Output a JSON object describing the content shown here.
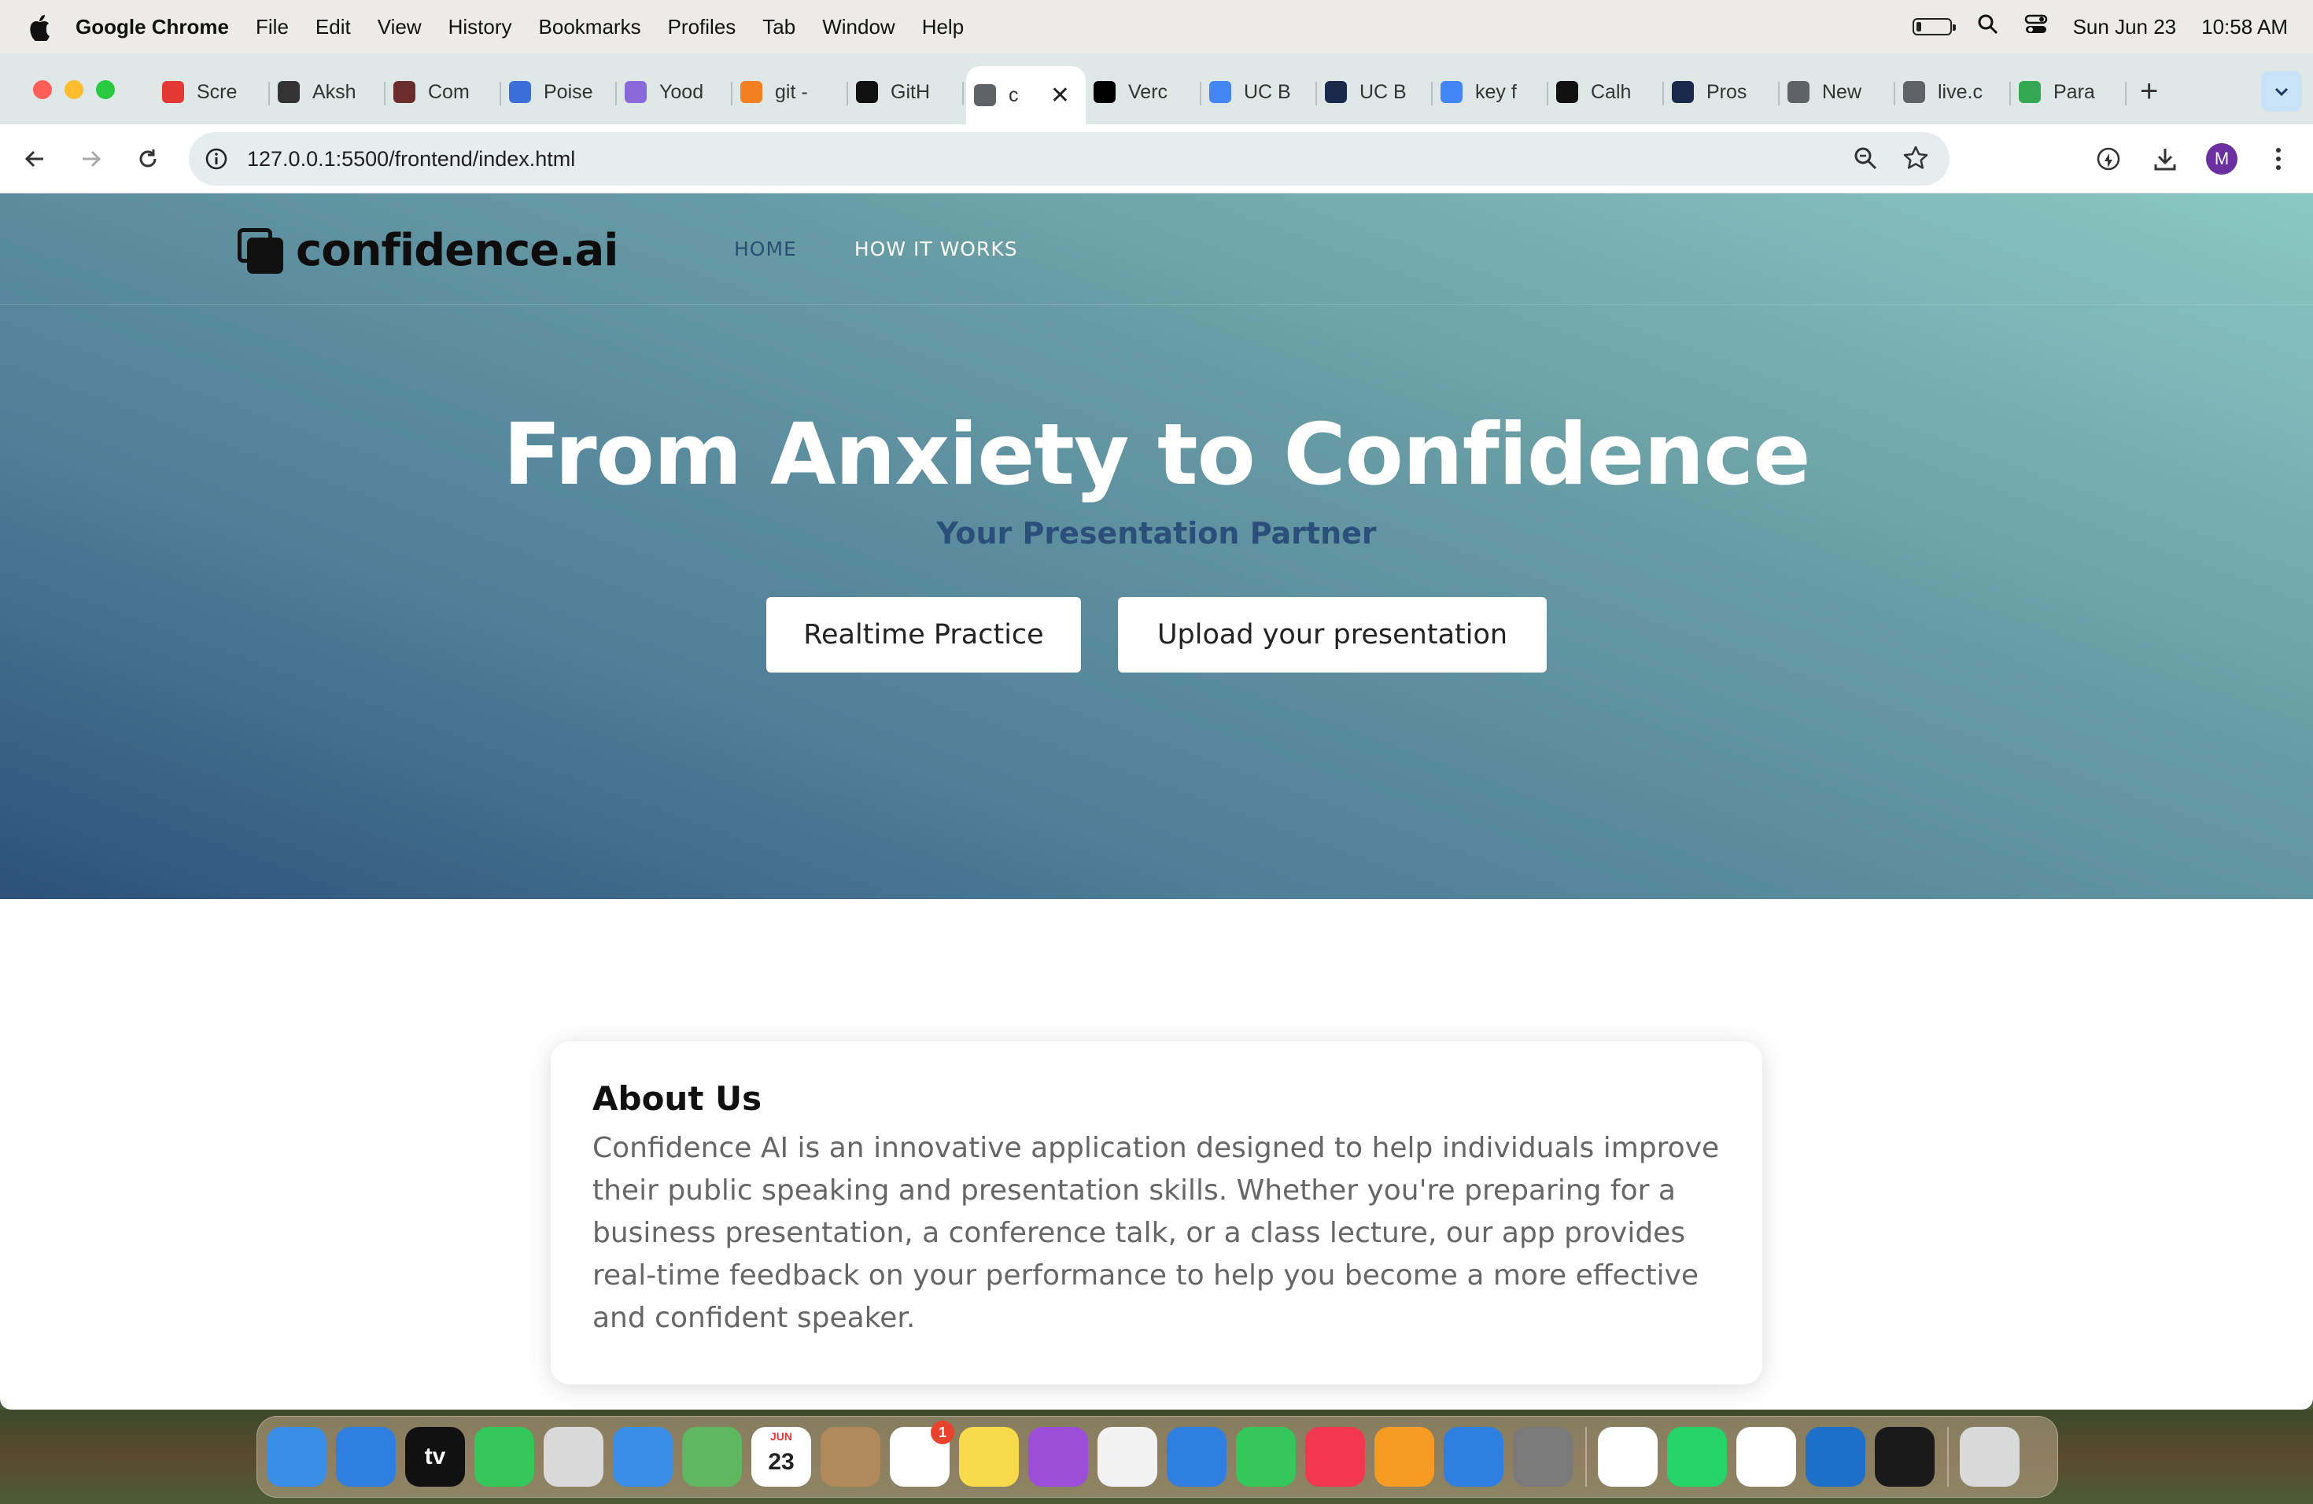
{
  "menubar": {
    "app_name": "Google Chrome",
    "items": [
      "File",
      "Edit",
      "View",
      "History",
      "Bookmarks",
      "Profiles",
      "Tab",
      "Window",
      "Help"
    ],
    "date": "Sun Jun 23",
    "time": "10:58 AM"
  },
  "tabs": [
    {
      "label": "Scre",
      "favicon_color": "#e53935",
      "icon": "screen-record-icon"
    },
    {
      "label": "Aksh",
      "favicon_color": "#333333",
      "icon": "openai-icon"
    },
    {
      "label": "Com",
      "favicon_color": "#6a2c2c",
      "icon": "app-icon"
    },
    {
      "label": "Poise",
      "favicon_color": "#3d6fd8",
      "icon": "poised-icon"
    },
    {
      "label": "Yood",
      "favicon_color": "#8a6ad8",
      "icon": "yoodli-icon"
    },
    {
      "label": "git -",
      "favicon_color": "#f48024",
      "icon": "stackoverflow-icon"
    },
    {
      "label": "GitH",
      "favicon_color": "#111111",
      "icon": "github-icon"
    },
    {
      "label": "c",
      "favicon_color": "#5f6368",
      "icon": "globe-icon",
      "active": true
    },
    {
      "label": "Verc",
      "favicon_color": "#000000",
      "icon": "vercel-icon"
    },
    {
      "label": "UC B",
      "favicon_color": "#4285f4",
      "icon": "google-docs-icon"
    },
    {
      "label": "UC B",
      "favicon_color": "#1b2a4a",
      "icon": "devpost-icon"
    },
    {
      "label": "key f",
      "favicon_color": "#4285f4",
      "icon": "google-icon"
    },
    {
      "label": "Calh",
      "favicon_color": "#111111",
      "icon": "medium-icon"
    },
    {
      "label": "Pros",
      "favicon_color": "#1b2a4a",
      "icon": "devpost-icon"
    },
    {
      "label": "New",
      "favicon_color": "#5f6368",
      "icon": "chrome-icon"
    },
    {
      "label": "live.c",
      "favicon_color": "#5f6368",
      "icon": "globe-icon"
    },
    {
      "label": "Para",
      "favicon_color": "#34a853",
      "icon": "android-icon"
    }
  ],
  "toolbar": {
    "url": "127.0.0.1:5500/frontend/index.html",
    "profile_initial": "M"
  },
  "site": {
    "logo_text": "confidence.ai",
    "nav": {
      "home": "HOME",
      "how": "HOW IT WORKS"
    },
    "headline": "From Anxiety to Confidence",
    "subheadline": "Your Presentation Partner",
    "btn_practice": "Realtime Practice",
    "btn_upload": "Upload your presentation",
    "about_title": "About Us",
    "about_text": "Confidence AI is an innovative application designed to help individuals improve their public speaking and presentation skills. Whether you're preparing for a business presentation, a conference talk, or a class lecture, our app provides real-time feedback on your performance to help you become a more effective and confident speaker."
  },
  "dock": {
    "apps": [
      {
        "name": "finder-icon",
        "color": "#3a8ee6"
      },
      {
        "name": "safari-icon",
        "color": "#2f7fe0"
      },
      {
        "name": "apple-tv-icon",
        "color": "#111111",
        "label": "tv"
      },
      {
        "name": "messages-icon",
        "color": "#34c759"
      },
      {
        "name": "launchpad-icon",
        "color": "#d9d9d9"
      },
      {
        "name": "mail-icon",
        "color": "#3a8ee6"
      },
      {
        "name": "maps-icon",
        "color": "#5fb85f"
      },
      {
        "name": "calendar-icon",
        "color": "#ffffff",
        "label": "23",
        "month": "JUN"
      },
      {
        "name": "contacts-icon",
        "color": "#b08a5a"
      },
      {
        "name": "reminders-icon",
        "color": "#ffffff",
        "badge": "1"
      },
      {
        "name": "notes-icon",
        "color": "#f7d94c"
      },
      {
        "name": "podcasts-icon",
        "color": "#9b4fd8"
      },
      {
        "name": "news-icon",
        "color": "#f2f2f2"
      },
      {
        "name": "keynote-icon",
        "color": "#2f7fe0"
      },
      {
        "name": "numbers-icon",
        "color": "#34c759"
      },
      {
        "name": "music-icon",
        "color": "#f2374f"
      },
      {
        "name": "pages-icon",
        "color": "#f59a23"
      },
      {
        "name": "app-store-icon",
        "color": "#2f7fe0"
      },
      {
        "name": "system-settings-icon",
        "color": "#7a7a7a"
      }
    ],
    "apps_after_sep": [
      {
        "name": "chrome-dock-icon",
        "color": "#ffffff"
      },
      {
        "name": "whatsapp-icon",
        "color": "#25d366"
      },
      {
        "name": "slack-icon",
        "color": "#ffffff"
      },
      {
        "name": "vscode-icon",
        "color": "#1e6fc8"
      },
      {
        "name": "terminal-icon",
        "color": "#1a1a1a"
      }
    ],
    "trash": {
      "name": "trash-icon",
      "color": "#d9d9d9"
    }
  }
}
